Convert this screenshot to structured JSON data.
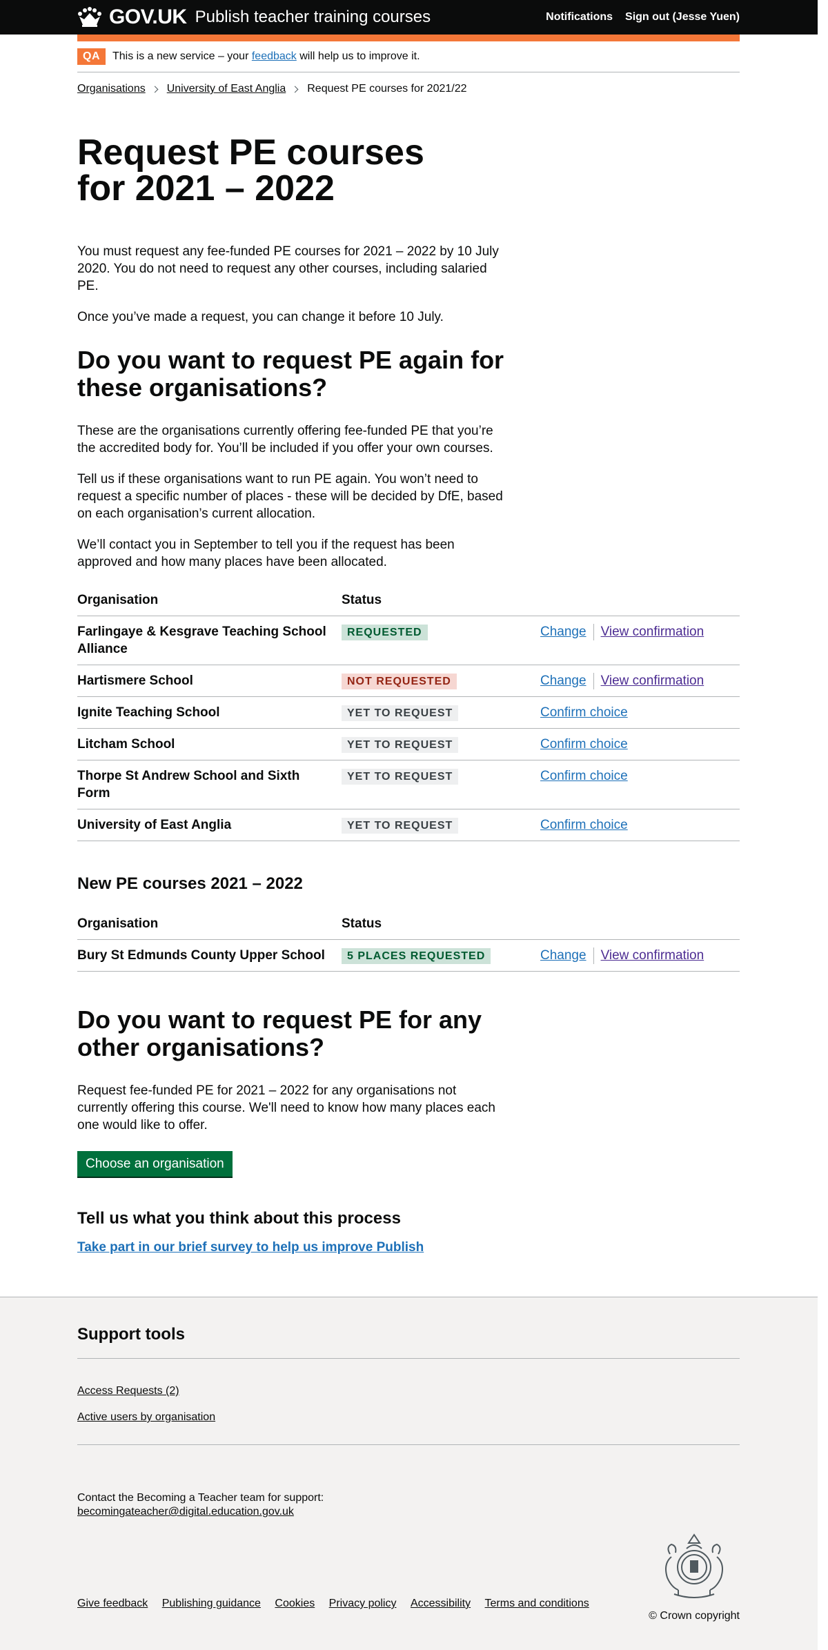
{
  "header": {
    "logotype": "GOV.UK",
    "service_name": "Publish teacher training courses",
    "nav": {
      "notifications": "Notifications",
      "sign_out": "Sign out (Jesse Yuen)"
    }
  },
  "phase_banner": {
    "tag": "QA",
    "text_before": "This is a new service – your",
    "feedback_link": "feedback",
    "text_after": "will help us to improve it."
  },
  "breadcrumbs": {
    "items": [
      "Organisations",
      "University of East Anglia"
    ],
    "current": "Request PE courses for 2021/22"
  },
  "title": "Request PE courses for 2021 – 2022",
  "intro": [
    "You must request any fee-funded PE courses for 2021 – 2022 by 10 July 2020. You do not need to request any other courses, including salaried PE.",
    "Once you’ve made a request, you can change it before 10 July."
  ],
  "section1": {
    "heading": "Do you want to request PE again for these organisations?",
    "paragraphs": [
      "These are the organisations currently offering fee-funded PE that you’re the accredited body for. You’ll be included if you offer your own courses.",
      "Tell us if these organisations want to run PE again. You won’t need to request a specific number of places - these will be decided by DfE, based on each organisation’s current allocation.",
      "We’ll contact you in September to tell you if the request has been approved and how many places have been allocated."
    ],
    "table": {
      "col_org": "Organisation",
      "col_status": "Status",
      "rows": [
        {
          "org": "Farlingaye & Kesgrave Teaching School Alliance",
          "status": "Requested",
          "action1": "Change",
          "action2": "View confirmation"
        },
        {
          "org": "Hartismere School",
          "status": "Not requested",
          "action1": "Change",
          "action2": "View confirmation"
        },
        {
          "org": "Ignite Teaching School",
          "status": "Yet to request",
          "action1": "Confirm choice"
        },
        {
          "org": "Litcham School",
          "status": "Yet to request",
          "action1": "Confirm choice"
        },
        {
          "org": "Thorpe St Andrew School and Sixth Form",
          "status": "Yet to request",
          "action1": "Confirm choice"
        },
        {
          "org": "University of East Anglia",
          "status": "Yet to request",
          "action1": "Confirm choice"
        }
      ]
    }
  },
  "section2": {
    "heading": "New PE courses 2021 – 2022",
    "table": {
      "col_org": "Organisation",
      "col_status": "Status",
      "rows": [
        {
          "org": "Bury St Edmunds County Upper School",
          "status": "5 places requested",
          "action1": "Change",
          "action2": "View confirmation"
        }
      ]
    }
  },
  "section3": {
    "heading": "Do you want to request PE for any other organisations?",
    "paragraph": "Request fee-funded PE for 2021 – 2022 for any organisations not currently offering this course. We'll need to know how many places each one would like to offer.",
    "button": "Choose an organisation"
  },
  "feedback": {
    "heading": "Tell us what you think about this process",
    "link": "Take part in our brief survey to help us improve Publish"
  },
  "footer": {
    "support_heading": "Support tools",
    "tools": [
      "Access Requests (2)",
      "Active users by organisation"
    ],
    "contact_text": "Contact the Becoming a Teacher team for support:",
    "contact_email": "becomingateacher@digital.education.gov.uk",
    "links": [
      "Give feedback",
      "Publishing guidance",
      "Cookies",
      "Privacy policy",
      "Accessibility",
      "Terms and conditions"
    ],
    "copyright": "© Crown copyright"
  }
}
